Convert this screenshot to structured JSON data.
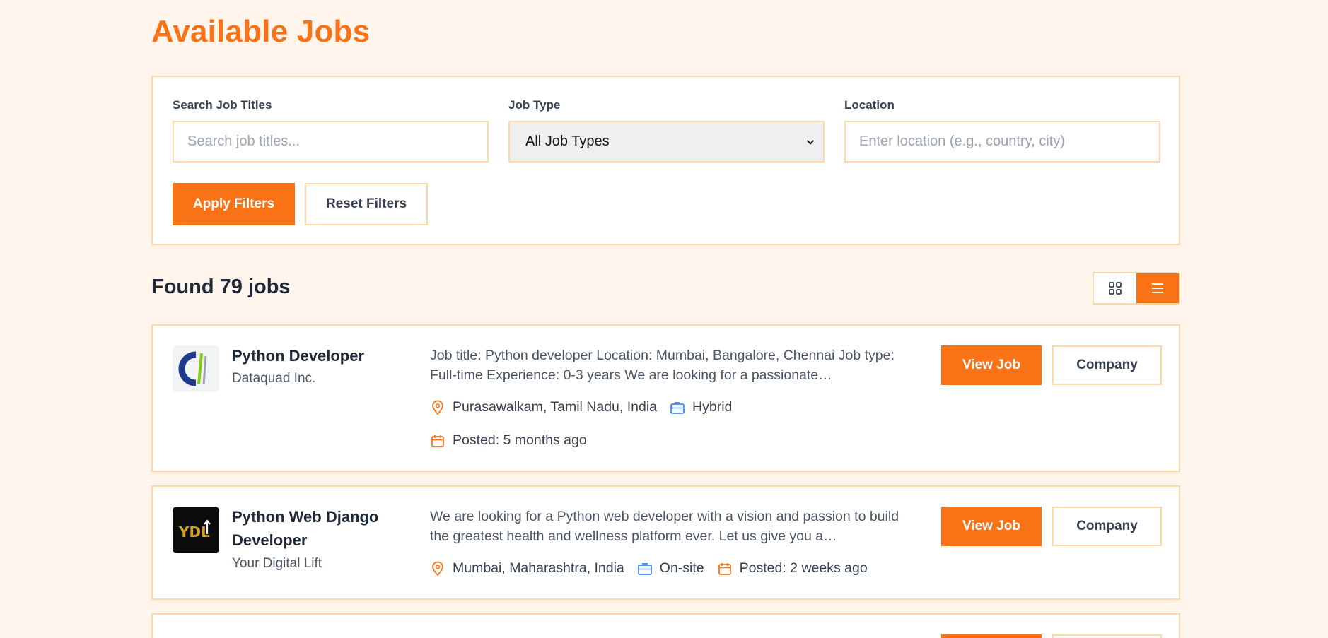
{
  "page": {
    "title": "Available Jobs"
  },
  "filters": {
    "search_label": "Search Job Titles",
    "search_placeholder": "Search job titles...",
    "type_label": "Job Type",
    "type_selected": "All Job Types",
    "location_label": "Location",
    "location_placeholder": "Enter location (e.g., country, city)",
    "apply_label": "Apply Filters",
    "reset_label": "Reset Filters"
  },
  "results": {
    "found_text": "Found 79 jobs"
  },
  "view_toggle": {
    "active": "list",
    "icons": [
      "grid-icon",
      "list-icon"
    ]
  },
  "jobs": [
    {
      "title": "Python Developer",
      "company": "Dataquad Inc.",
      "description": "Job title: Python developer Location: Mumbai, Bangalore, Chennai Job type: Full-time Experience: 0-3 years We are looking for a passionate…",
      "location": "Purasawalkam, Tamil Nadu, India",
      "work_mode": "Hybrid",
      "posted": "Posted: 5 months ago",
      "view_label": "View Job",
      "company_label": "Company"
    },
    {
      "title": "Python Web Django Developer",
      "company": "Your Digital Lift",
      "description": "We are looking for a Python web developer with a vision and passion to build the greatest health and wellness platform ever. Let us give you a…",
      "location": "Mumbai, Maharashtra, India",
      "work_mode": "On-site",
      "posted": "Posted: 2 weeks ago",
      "view_label": "View Job",
      "company_label": "Company",
      "logo_text": "YDL"
    }
  ],
  "colors": {
    "accent": "#f97316",
    "border": "#fcd9a8",
    "background": "#fff5ec",
    "briefcase": "#3b82f6"
  }
}
